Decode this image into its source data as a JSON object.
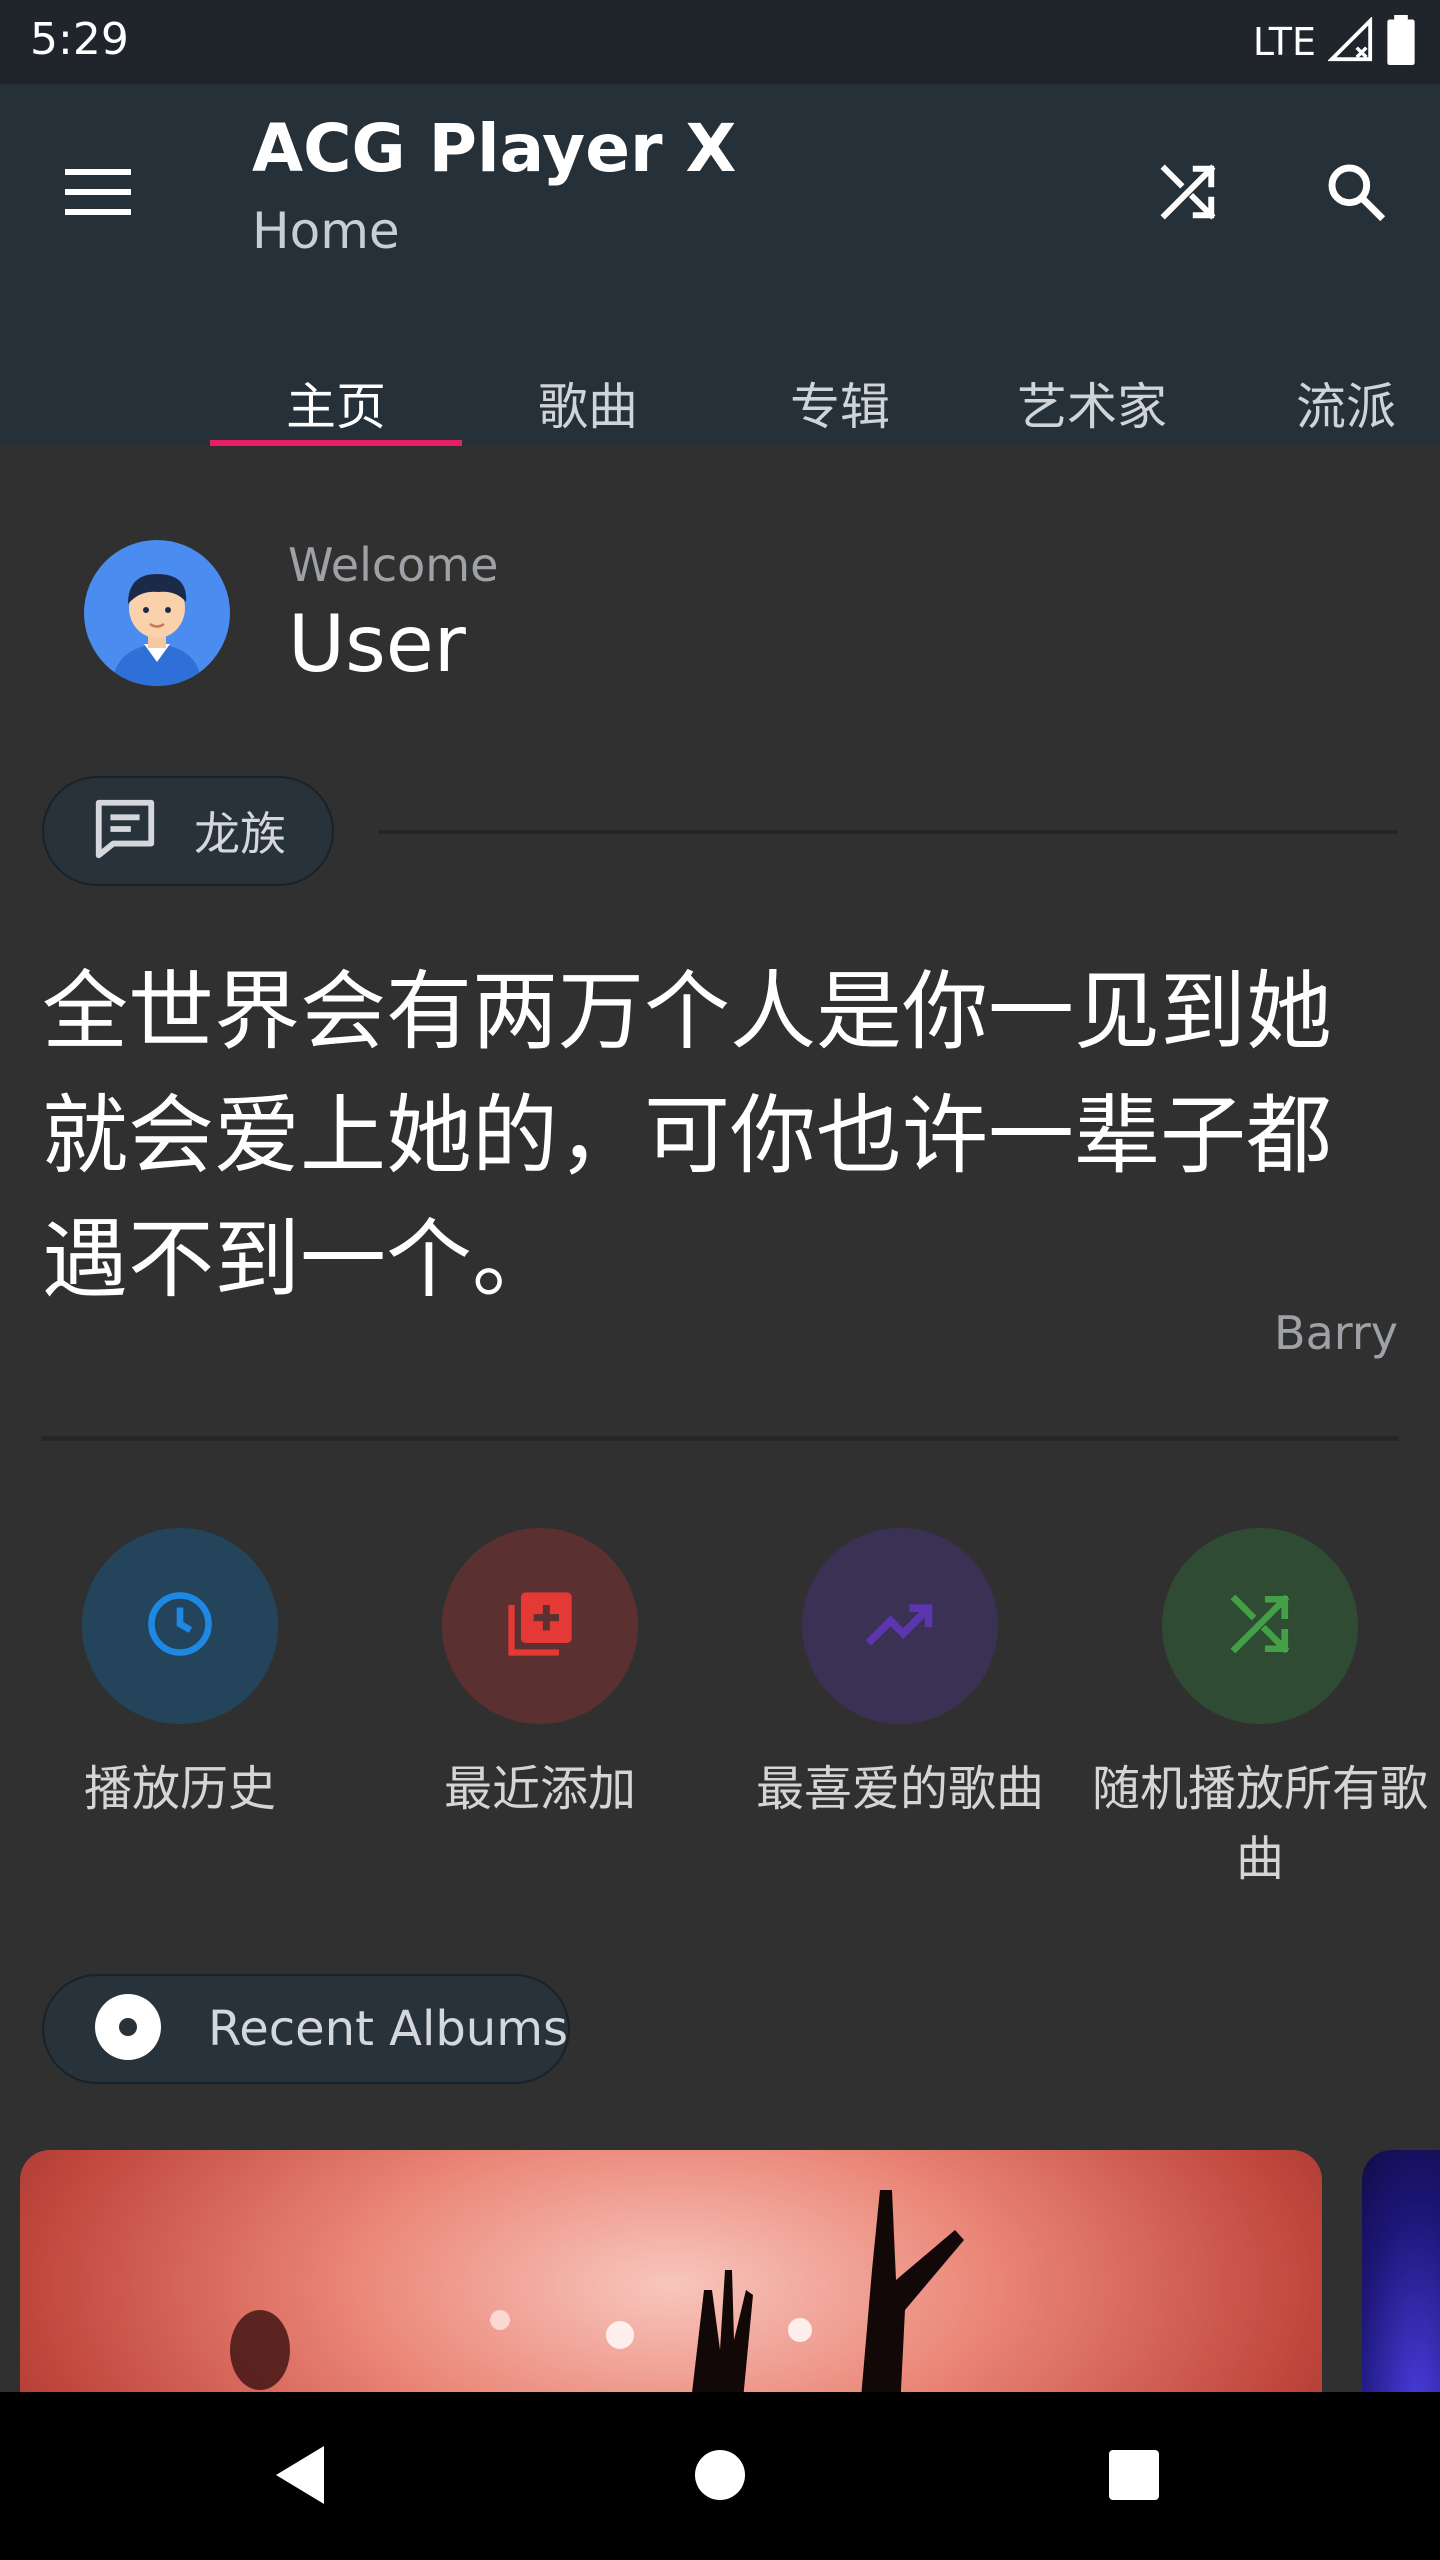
{
  "status_bar": {
    "time": "5:29",
    "network": "LTE"
  },
  "app_bar": {
    "title": "ACG Player X",
    "subtitle": "Home",
    "icons": [
      "menu-icon",
      "shuffle-icon",
      "search-icon"
    ]
  },
  "tabs": [
    {
      "label": "主页",
      "active": true
    },
    {
      "label": "歌曲",
      "active": false
    },
    {
      "label": "专辑",
      "active": false
    },
    {
      "label": "艺术家",
      "active": false
    },
    {
      "label": "流派",
      "active": false
    }
  ],
  "welcome": {
    "label": "Welcome",
    "user": "User"
  },
  "quote": {
    "chip_label": "龙族",
    "text": "全世界会有两万个人是你一见到她就会爱上她的，可你也许一辈子都遇不到一个。",
    "author": "Barry"
  },
  "shortcuts": [
    {
      "label": "播放历史",
      "icon": "history-clock-icon",
      "color": "#1e88e5"
    },
    {
      "label": "最近添加",
      "icon": "library-add-icon",
      "color": "#e53935"
    },
    {
      "label": "最喜爱的歌曲",
      "icon": "trending-up-icon",
      "color": "#5e35b1"
    },
    {
      "label": "随机播放所有歌曲",
      "icon": "shuffle-icon",
      "color": "#43a047"
    }
  ],
  "recent_albums": {
    "chip_label": "Recent Albums"
  },
  "colors": {
    "accent": "#e91e63",
    "app_bar": "#263038",
    "background": "#303030"
  }
}
